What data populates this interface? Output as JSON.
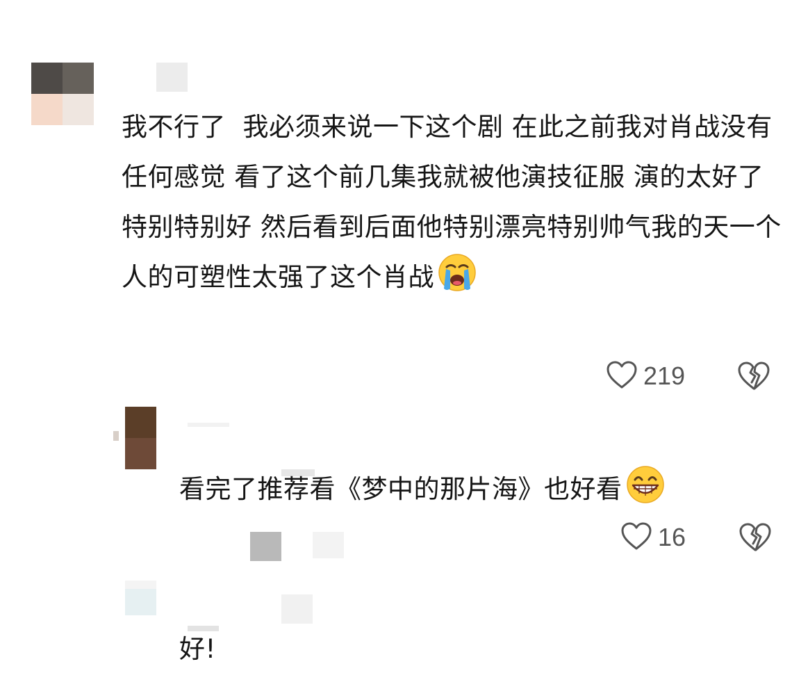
{
  "comments": {
    "main": {
      "text": "我不行了  我必须来说一下这个剧 在此之前我对肖战没有任何感觉 看了这个前几集我就被他演技征服 演的太好了 特别特别好 然后看到后面他特别漂亮特别帅气我的天一个人的可塑性太强了这个肖战",
      "emoji": "loudly-crying-face-icon",
      "like_count": "219"
    },
    "reply_1": {
      "text": "看完了推荐看《梦中的那片海》也好看",
      "emoji": "grinning-face-icon",
      "like_count": "16"
    },
    "reply_2": {
      "text": "好!"
    }
  },
  "icons": {
    "like": "heart-outline-icon",
    "dislike": "broken-heart-icon"
  },
  "colors": {
    "text": "#151515",
    "count": "#555555",
    "icon": "#555555",
    "background": "#ffffff"
  }
}
